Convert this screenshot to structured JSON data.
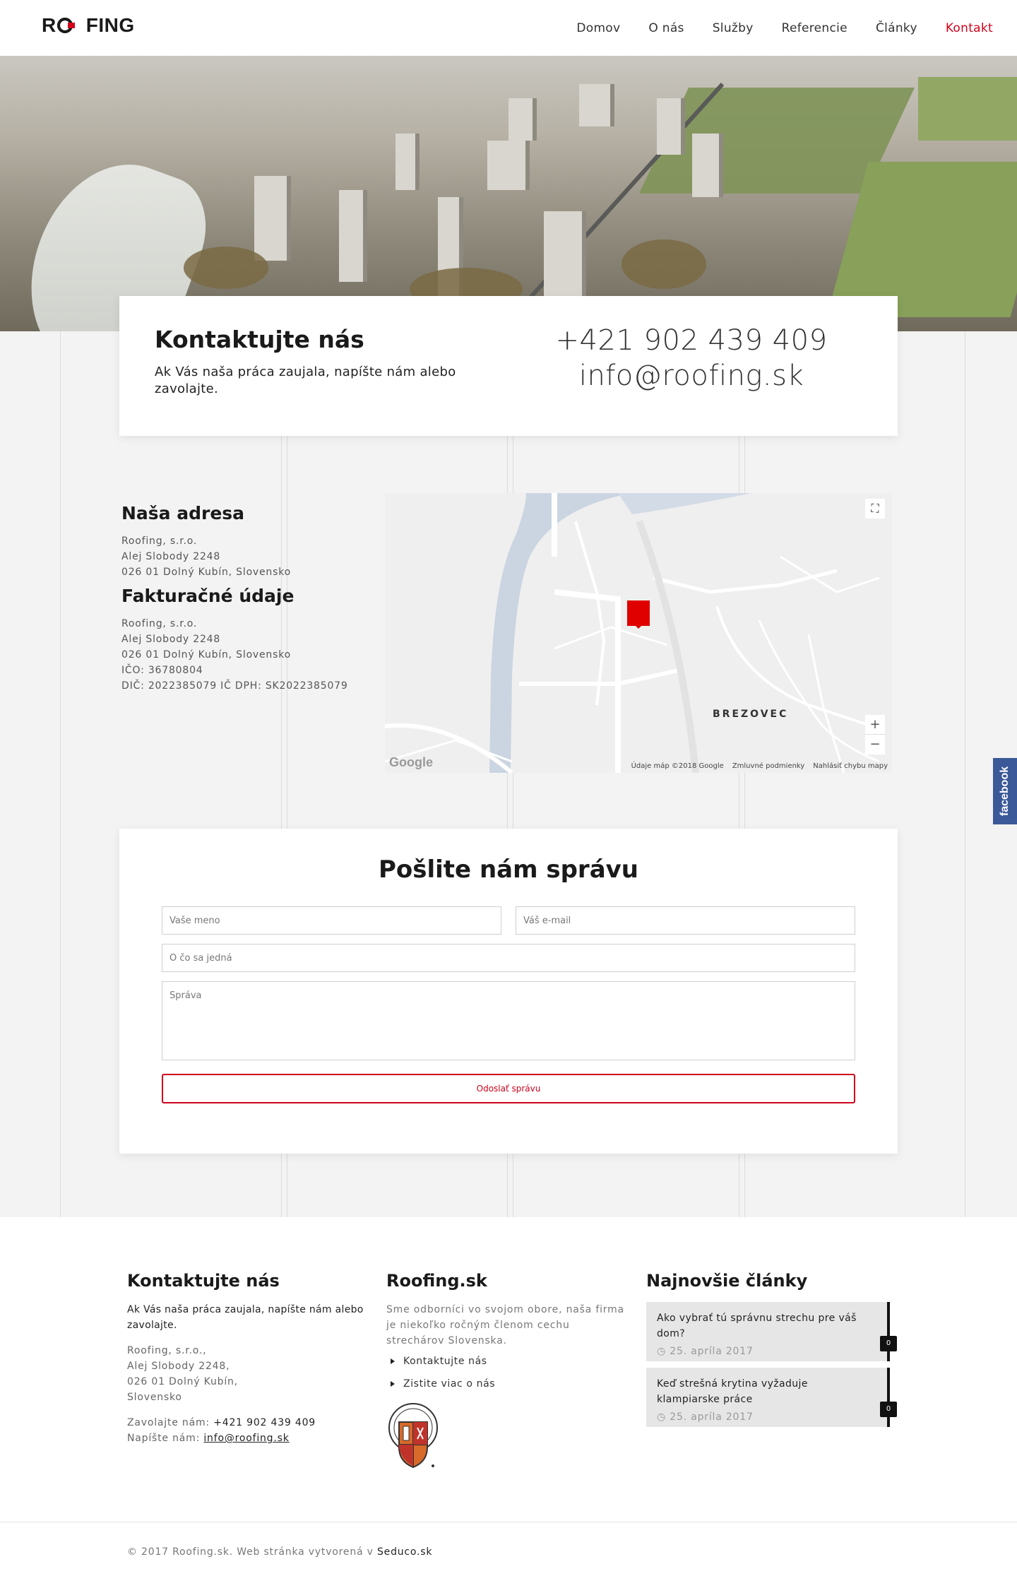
{
  "header": {
    "logo": "ROOFING",
    "nav": [
      "Domov",
      "O nás",
      "Služby",
      "Referencie",
      "Články",
      "Kontakt"
    ],
    "active": "Kontakt"
  },
  "contact_card": {
    "title": "Kontaktujte nás",
    "text": "Ak Vás naša práca zaujala, napíšte nám alebo zavolajte.",
    "phone": "+421 902 439 409",
    "email": "info@roofing.sk"
  },
  "address": {
    "title": "Naša adresa",
    "lines": [
      "Roofing, s.r.o.",
      "Alej Slobody 2248",
      "026 01 Dolný Kubín, Slovensko"
    ],
    "billing_title": "Fakturačné údaje",
    "billing_lines": [
      "Roofing, s.r.o.",
      "Alej Slobody 2248",
      "026 01 Dolný Kubín, Slovensko",
      "IČO: 36780804",
      "DIČ: 2022385079 IČ DPH: SK2022385079"
    ]
  },
  "map": {
    "district": "BREZOVEC",
    "brand": "Google",
    "footer": [
      "Údaje máp ©2018 Google",
      "Zmluvné podmienky",
      "Nahlásiť chybu mapy"
    ],
    "zoom_in": "+",
    "zoom_out": "−",
    "fullscreen": "⛶"
  },
  "form": {
    "title": "Pošlite nám správu",
    "name_placeholder": "Vaše meno",
    "email_placeholder": "Váš e-mail",
    "subject_placeholder": "O čo sa jedná",
    "message_placeholder": "Správa",
    "submit": "Odoslať správu"
  },
  "facebook_tab": "facebook",
  "footer": {
    "col1": {
      "title": "Kontaktujte nás",
      "lead": "Ak Vás naša práca zaujala, napíšte nám alebo zavolajte.",
      "address": [
        "Roofing, s.r.o.,",
        "Alej Slobody 2248,",
        "026 01 Dolný Kubín,",
        "Slovensko"
      ],
      "call_label": "Zavolajte nám:",
      "call_value": "+421 902 439 409",
      "write_label": "Napíšte nám:",
      "write_value": "info@roofing.sk"
    },
    "col2": {
      "title": "Roofing.sk",
      "lead": "Sme odborníci vo svojom obore, naša firma je niekoľko ročným členom cechu strechárov Slovenska.",
      "links": [
        "Kontaktujte nás",
        "Zistite viac o nás"
      ]
    },
    "col3": {
      "title": "Najnovšie články",
      "articles": [
        {
          "title": "Ako vybrať tú správnu strechu pre váš dom?",
          "date": "25. apríla 2017",
          "comments": "0"
        },
        {
          "title": "Keď strešná krytina vyžaduje klampiarske práce",
          "date": "25. apríla 2017",
          "comments": "0"
        }
      ]
    },
    "copyright": "© 2017 Roofing.sk. Web stránka vytvorená v",
    "copyright_link": "Seduco.sk"
  },
  "colors": {
    "accent": "#d0021b",
    "facebook": "#3b5998"
  }
}
